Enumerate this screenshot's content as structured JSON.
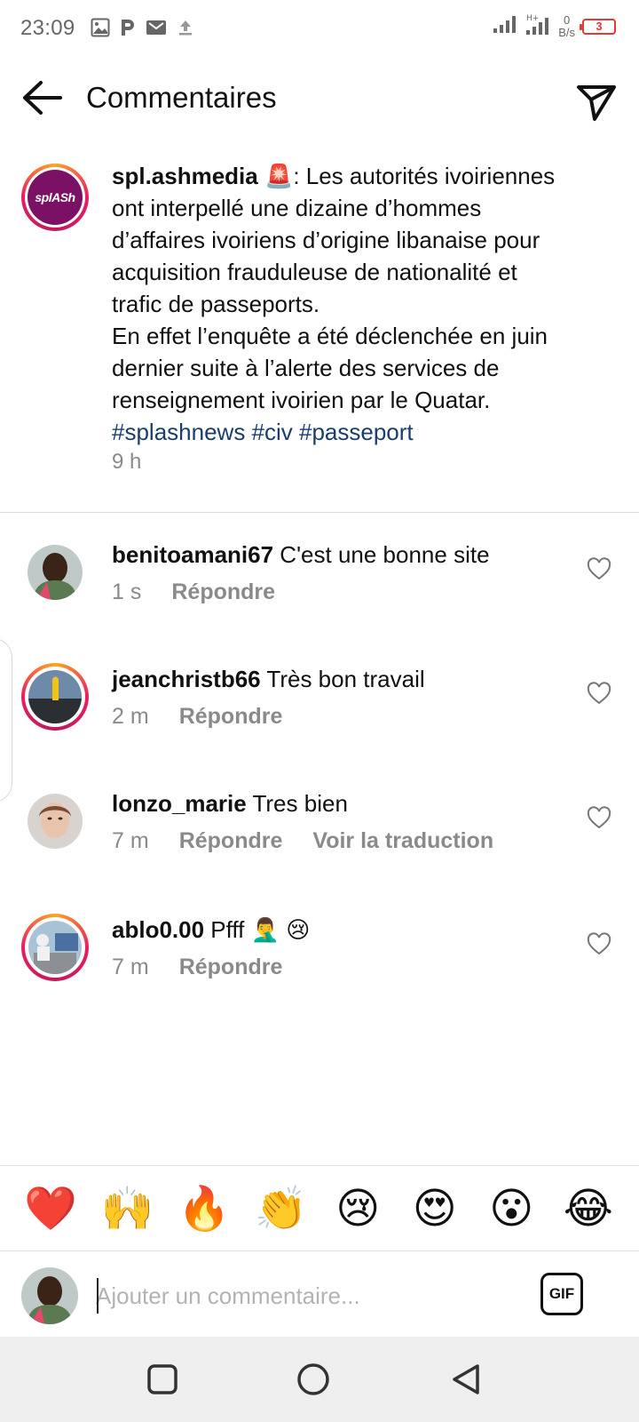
{
  "status_bar": {
    "time": "23:09",
    "netspeed_value": "0",
    "netspeed_unit": "B/s",
    "battery": "3",
    "icons": [
      "gallery-icon",
      "p-icon",
      "mail-icon",
      "upload-icon",
      "signal-icon",
      "signal-h-plus-icon"
    ]
  },
  "header": {
    "title": "Commentaires"
  },
  "post": {
    "username": "spl.ashmedia",
    "emoji": "🚨",
    "text": ": Les autorités ivoiriennes ont interpellé une dizaine d’hommes d’affaires ivoiriens d’origine libanaise pour acquisition frauduleuse de nationalité et trafic de passeports.",
    "text2": "En effet l’enquête a été déclenchée en juin dernier suite à l’alerte des services de renseignement ivoirien par le Quatar.",
    "hashtags": "#splashnews #civ #passeport",
    "time": "9 h",
    "avatar_label": "splASh"
  },
  "comments": [
    {
      "username": "benitoamani67",
      "text": "C'est une bonne site",
      "time": "1 s",
      "reply": "Répondre",
      "translate": ""
    },
    {
      "username": "jeanchristb66",
      "text": "Très bon travail",
      "time": "2 m",
      "reply": "Répondre",
      "translate": ""
    },
    {
      "username": "lonzo_marie",
      "text": "Tres bien",
      "time": "7 m",
      "reply": "Répondre",
      "translate": "Voir la traduction"
    },
    {
      "username": "ablo0.00",
      "text": "Pfff 🤦‍♂️ 😢",
      "time": "7 m",
      "reply": "Répondre",
      "translate": ""
    }
  ],
  "reactions": [
    "❤️",
    "🙌",
    "🔥",
    "👏",
    "😢",
    "😍",
    "😮",
    "😂"
  ],
  "composer": {
    "placeholder": "Ajouter un commentaire...",
    "gif_label": "GIF"
  },
  "colors": {
    "hashtag": "#1a3d6e",
    "meta_gray": "#8a8a8a",
    "story_ring_start": "#f9a825",
    "story_ring_end": "#c2185b",
    "battery_red": "#e53935",
    "avatar_brand": "#7b1165"
  }
}
